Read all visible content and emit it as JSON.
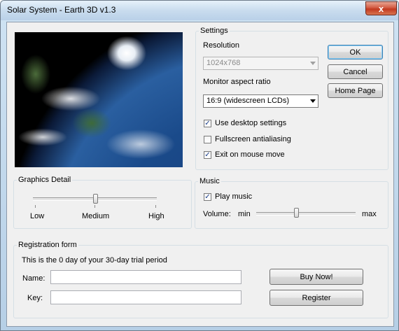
{
  "window": {
    "title": "Solar System - Earth 3D v1.3",
    "close_glyph": "x"
  },
  "settings": {
    "group_label": "Settings",
    "resolution_label": "Resolution",
    "resolution_value": "1024x768",
    "aspect_label": "Monitor aspect ratio",
    "aspect_value": "16:9 (widescreen LCDs)",
    "use_desktop": {
      "label": "Use desktop settings",
      "checked": true
    },
    "fullscreen_aa": {
      "label": "Fullscreen antialiasing",
      "checked": false
    },
    "exit_mouse": {
      "label": "Exit on mouse move",
      "checked": true
    }
  },
  "buttons": {
    "ok": "OK",
    "cancel": "Cancel",
    "home": "Home Page"
  },
  "graphics": {
    "group_label": "Graphics Detail",
    "low": "Low",
    "medium": "Medium",
    "high": "High",
    "level": 0.5
  },
  "music": {
    "group_label": "Music",
    "play": {
      "label": "Play music",
      "checked": true
    },
    "volume_label": "Volume:",
    "min": "min",
    "max": "max",
    "volume": 0.4
  },
  "registration": {
    "group_label": "Registration form",
    "trial_text": "This is the 0 day of your 30-day trial period",
    "name_label": "Name:",
    "key_label": "Key:",
    "name_value": "",
    "key_value": "",
    "buy_label": "Buy Now!",
    "register_label": "Register"
  }
}
